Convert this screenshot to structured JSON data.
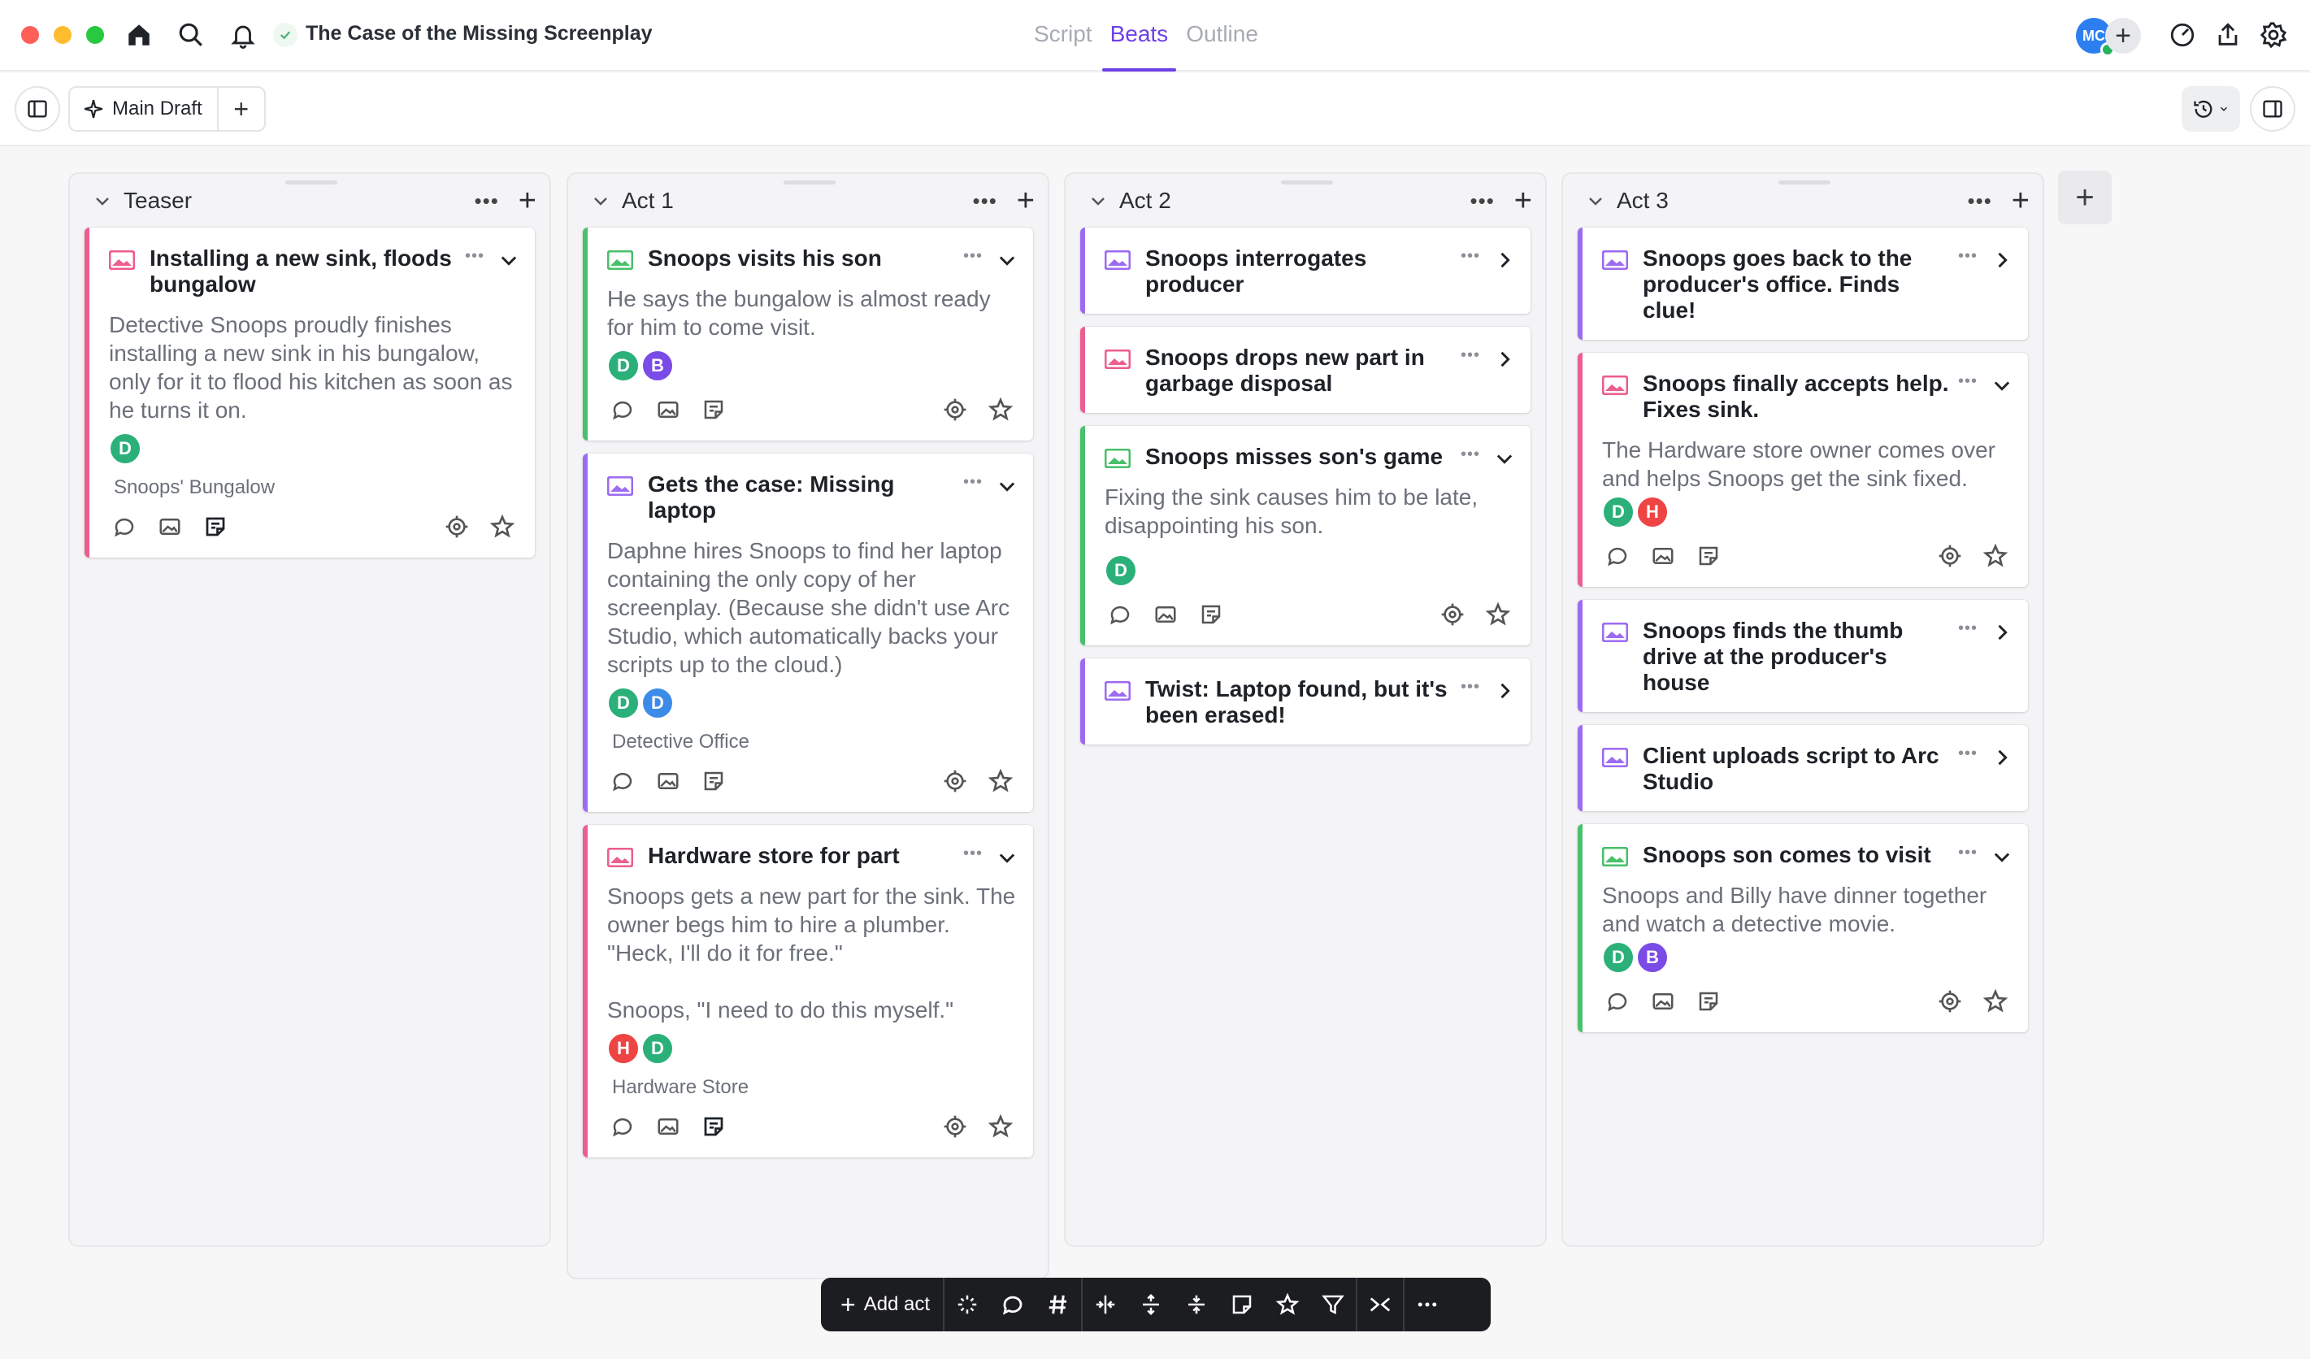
{
  "window": {
    "title": "The Case of the Missing Screenplay",
    "modes": [
      "Script",
      "Beats",
      "Outline"
    ],
    "active_mode": "Beats",
    "user_initials": "MC"
  },
  "toolbar": {
    "draft_label": "Main Draft"
  },
  "colors": {
    "accent": "#6d40e6",
    "pink": "#ec5e8f",
    "green": "#49c06b",
    "purple": "#9d6bf2"
  },
  "columns": [
    {
      "title": "Teaser",
      "cards": [
        {
          "color": "pink",
          "title": "Installing a new sink, floods bungalow",
          "expanded": true,
          "description": "Detective Snoops proudly finishes installing a new sink in his bungalow, only for it to flood his kitchen as soon as he turns it on.",
          "avatars": [
            "D"
          ],
          "location": "Snoops' Bungalow"
        }
      ]
    },
    {
      "title": "Act 1",
      "cards": [
        {
          "color": "green",
          "title": "Snoops visits his son",
          "expanded": true,
          "description": "He says the bungalow is almost ready for him to come visit.",
          "avatars": [
            "D",
            "B"
          ],
          "location": ""
        },
        {
          "color": "purple",
          "title": "Gets the case: Missing laptop",
          "expanded": true,
          "description": "Daphne hires Snoops to find her laptop containing the only copy of her screenplay. (Because she didn't use Arc Studio, which automatically backs your scripts up to the cloud.)",
          "avatars": [
            "D",
            "D"
          ],
          "location": "Detective Office"
        },
        {
          "color": "pink",
          "title": "Hardware store for part",
          "expanded": true,
          "description": "Snoops gets a new part for the sink. The owner begs him to hire a plumber. \"Heck, I'll do it for free.\"\n\nSnoops, \"I need to do this myself.\"",
          "avatars": [
            "H",
            "D"
          ],
          "location": "Hardware Store"
        }
      ]
    },
    {
      "title": "Act 2",
      "cards": [
        {
          "color": "purple",
          "title": "Snoops interrogates producer",
          "expanded": false
        },
        {
          "color": "pink",
          "title": "Snoops drops new part in garbage disposal",
          "expanded": false
        },
        {
          "color": "green",
          "title": "Snoops misses son's game",
          "expanded": true,
          "description": "Fixing the sink causes him to be late, disappointing his son.",
          "avatars": [
            "D"
          ],
          "location": ""
        },
        {
          "color": "purple",
          "title": "Twist: Laptop found, but it's been erased!",
          "expanded": false
        }
      ]
    },
    {
      "title": "Act 3",
      "cards": [
        {
          "color": "purple",
          "title": "Snoops goes back to the producer's office. Finds clue!",
          "expanded": false
        },
        {
          "color": "pink",
          "title": "Snoops finally accepts help. Fixes sink.",
          "expanded": true,
          "description": "The Hardware store owner comes over and helps Snoops get the sink fixed.",
          "avatars": [
            "D",
            "H"
          ],
          "location": ""
        },
        {
          "color": "purple",
          "title": "Snoops finds the thumb drive at the producer's house",
          "expanded": false
        },
        {
          "color": "purple",
          "title": "Client uploads script to Arc Studio",
          "expanded": false
        },
        {
          "color": "green",
          "title": "Snoops son comes to visit",
          "expanded": true,
          "description": "Snoops and Billy have dinner together and watch a detective movie.",
          "avatars": [
            "D",
            "B"
          ],
          "location": ""
        }
      ]
    }
  ],
  "bottom_bar": {
    "add_act_label": "Add act",
    "icons": [
      "sparkle-icon",
      "comment-icon",
      "hashtag-icon",
      "split-horizontal-icon",
      "expand-vertical-icon",
      "collapse-vertical-icon",
      "note-icon",
      "star-icon",
      "filter-icon",
      "collapse-all-icon",
      "more-icon"
    ]
  }
}
